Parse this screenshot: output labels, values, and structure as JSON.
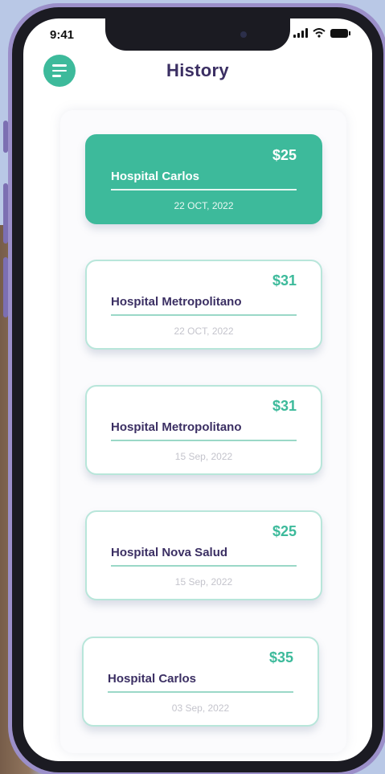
{
  "status_bar": {
    "time": "9:41"
  },
  "header": {
    "title": "History"
  },
  "history": [
    {
      "amount": "$25",
      "hospital": "Hospital Carlos",
      "date": "22 OCT, 2022",
      "active": true
    },
    {
      "amount": "$31",
      "hospital": "Hospital Metropolitano",
      "date": "22 OCT, 2022",
      "active": false
    },
    {
      "amount": "$31",
      "hospital": "Hospital Metropolitano",
      "date": "15 Sep, 2022",
      "active": false
    },
    {
      "amount": "$25",
      "hospital": "Hospital Nova Salud",
      "date": "15 Sep, 2022",
      "active": false
    },
    {
      "amount": "$35",
      "hospital": "Hospital Carlos",
      "date": "03 Sep, 2022",
      "active": false
    }
  ],
  "icons": {
    "menu": "menu-icon",
    "signal": "signal-icon",
    "wifi": "wifi-icon",
    "battery": "battery-icon"
  },
  "colors": {
    "accent": "#3dba9b",
    "title": "#3b2f63",
    "frame": "#9b8fc9",
    "background": "#b9c8e6"
  }
}
